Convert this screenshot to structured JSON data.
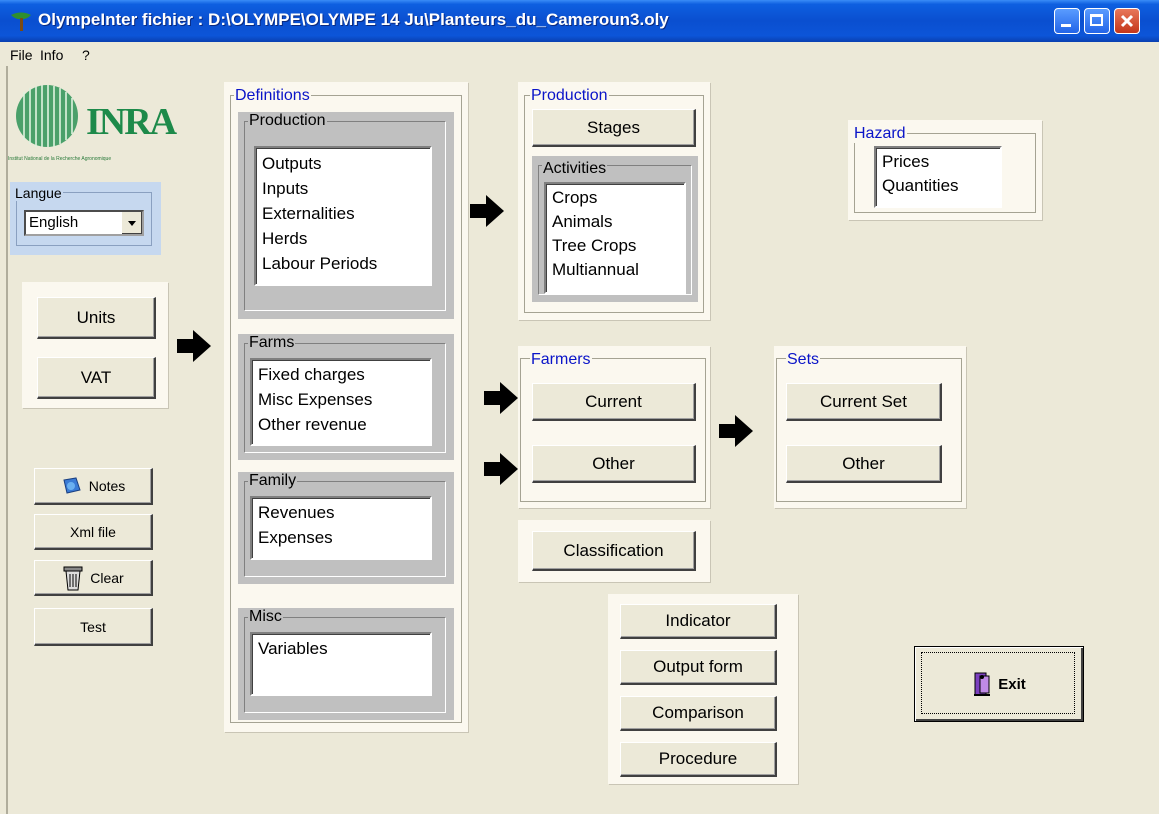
{
  "window": {
    "title": "OlympeInter  fichier : D:\\OLYMPE\\OLYMPE 14 Ju\\Planteurs_du_Cameroun3.oly"
  },
  "menu": [
    "File",
    "Info",
    "?"
  ],
  "logo": {
    "text": "INRA",
    "caption": "Institut National de la Recherche Agronomique"
  },
  "langue": {
    "label": "Langue",
    "selected": "English"
  },
  "left_buttons": {
    "units": "Units",
    "vat": "VAT"
  },
  "tool_buttons": {
    "notes": "Notes",
    "xml": "Xml file",
    "clear": "Clear",
    "test": "Test"
  },
  "definitions": {
    "title": "Definitions",
    "production": {
      "title": "Production",
      "items": [
        "Outputs",
        "Inputs",
        "Externalities",
        "Herds",
        "Labour Periods"
      ]
    },
    "farms": {
      "title": "Farms",
      "items": [
        "Fixed charges",
        "Misc Expenses",
        "Other revenue"
      ]
    },
    "family": {
      "title": "Family",
      "items": [
        "Revenues",
        "Expenses"
      ]
    },
    "misc": {
      "title": "Misc",
      "items": [
        "Variables"
      ]
    }
  },
  "production": {
    "title": "Production",
    "stages": "Stages",
    "activities": {
      "title": "Activities",
      "items": [
        "Crops",
        "Animals",
        "Tree Crops",
        "Multiannual"
      ]
    }
  },
  "hazard": {
    "title": "Hazard",
    "items": [
      "Prices",
      "Quantities"
    ]
  },
  "farmers": {
    "title": "Farmers",
    "current": "Current",
    "other": "Other"
  },
  "sets": {
    "title": "Sets",
    "current": "Current Set",
    "other": "Other"
  },
  "classification": "Classification",
  "analysis": {
    "indicator": "Indicator",
    "output_form": "Output form",
    "comparison": "Comparison",
    "procedure": "Procedure"
  },
  "exit": "Exit"
}
